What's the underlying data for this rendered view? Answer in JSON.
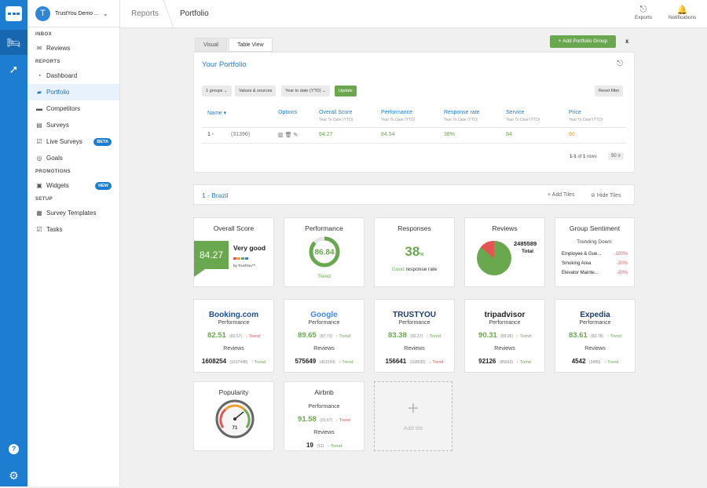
{
  "rail": {
    "icons": [
      "logo-icon",
      "hotel-icon",
      "rocket-icon",
      "help-icon",
      "gear-icon"
    ]
  },
  "account": {
    "initial": "T",
    "name": "TrustYou Demo ..."
  },
  "sidebar": {
    "inbox_label": "INBOX",
    "reports_label": "REPORTS",
    "promotions_label": "PROMOTIONS",
    "setup_label": "SETUP",
    "items": [
      {
        "label": "Reviews",
        "icon": "✉"
      },
      {
        "label": "Dashboard",
        "icon": "◔"
      },
      {
        "label": "Portfolio",
        "icon": "▰"
      },
      {
        "label": "Competitors",
        "icon": "▬"
      },
      {
        "label": "Surveys",
        "icon": "▤"
      },
      {
        "label": "Live Surveys",
        "icon": "☑",
        "badge": "BETA"
      },
      {
        "label": "Goals",
        "icon": "◎"
      },
      {
        "label": "Widgets",
        "icon": "▣",
        "badge": "NEW"
      },
      {
        "label": "Survey Templates",
        "icon": "▦"
      },
      {
        "label": "Tasks",
        "icon": "☑"
      }
    ]
  },
  "header": {
    "crumb1": "Reports",
    "crumb2": "Portfolio",
    "exports": "Exports",
    "notifications": "Notifications"
  },
  "tabs": {
    "visual": "Visual",
    "table": "Table View"
  },
  "add_group": "+ Add Portfolio Group",
  "close": "x",
  "portfolio": {
    "title": "Your Portfolio",
    "filters": {
      "groups": "1 groups ⌄",
      "values": "Values & sources",
      "period": "Year to date (YTD) ⌄",
      "update": "Update",
      "reset": "Reset filter"
    },
    "columns": [
      {
        "label": "Name ▾",
        "sub": ""
      },
      {
        "label": "Options",
        "sub": ""
      },
      {
        "label": "Overall Score",
        "sub": "Year To Date (YTD)"
      },
      {
        "label": "Performance",
        "sub": "Year To Date (YTD)"
      },
      {
        "label": "Response rate",
        "sub": "Year To Date (YTD)"
      },
      {
        "label": "Service",
        "sub": "Year To Date (YTD)"
      },
      {
        "label": "Price",
        "sub": "Year To Date (YTD)"
      }
    ],
    "row": {
      "name": "1 -",
      "id": "(31396)",
      "overall": "84.27",
      "performance": "84.54",
      "response": "38%",
      "service": "84",
      "price": "60"
    },
    "pagination": {
      "range": "1-1",
      "of": "of",
      "total": "1",
      "rows": "rows",
      "per_page": "50"
    }
  },
  "group": {
    "title": "1 - Brazil",
    "add_tiles": "Add Tiles",
    "hide_tiles": "Hide Tiles"
  },
  "tiles": {
    "overall": {
      "title": "Overall Score",
      "score": "84.27",
      "label": "Very good",
      "by": "by TrustYou™"
    },
    "performance": {
      "title": "Performance",
      "value": "86.84",
      "trend": "Trend",
      "fraction": 0.87
    },
    "responses": {
      "title": "Responses",
      "value": "38",
      "unit": "%",
      "label_good": "Good",
      "label_rest": "response rate"
    },
    "reviews": {
      "title": "Reviews",
      "count": "2485589",
      "total": "Total"
    },
    "sentiment": {
      "title": "Group Sentiment",
      "subtitle": "Trending Down:",
      "items": [
        {
          "label": "Employee & Gue...",
          "value": "-100%"
        },
        {
          "label": "Smoking Area",
          "value": "-30%"
        },
        {
          "label": "Elevator Mainte...",
          "value": "-20%"
        }
      ]
    },
    "sources": [
      {
        "brand": "Booking.com",
        "perf": "82.51",
        "prev": "(82.67)",
        "ptrend": "Trend",
        "pdir": "down",
        "reviews": "1608254",
        "rprev": "(1537448)",
        "rtrend": "Trend",
        "rdir": "up"
      },
      {
        "brand": "Google",
        "perf": "89.65",
        "prev": "(87.73)",
        "ptrend": "Trend",
        "pdir": "up",
        "reviews": "575649",
        "rprev": "(463104)",
        "rtrend": "Trend",
        "rdir": "up"
      },
      {
        "brand": "TRUSTYOU",
        "perf": "83.38",
        "prev": "(83.37)",
        "ptrend": "Trend",
        "pdir": "up",
        "reviews": "156641",
        "rprev": "(168030)",
        "rtrend": "Trend",
        "rdir": "down"
      },
      {
        "brand": "tripadvisor",
        "perf": "90.31",
        "prev": "(89.26)",
        "ptrend": "Trend",
        "pdir": "up",
        "reviews": "92126",
        "rprev": "(85810)",
        "rtrend": "Trend",
        "rdir": "up"
      },
      {
        "brand": "Expedia",
        "perf": "83.61",
        "prev": "(83.78)",
        "ptrend": "Trend",
        "pdir": "up",
        "reviews": "4542",
        "rprev": "(3489)",
        "rtrend": "Trend",
        "rdir": "up"
      }
    ],
    "perf_label": "Performance",
    "reviews_label": "Reviews",
    "popularity": {
      "title": "Popularity",
      "value": "71"
    },
    "airbnb": {
      "title": "Airbnb",
      "perf": "91.58",
      "prev": "(91.67)",
      "ptrend": "Trend",
      "reviews": "19",
      "rprev": "(12)",
      "rtrend": "Trend"
    },
    "add_tile": {
      "label": "Add tile"
    }
  },
  "colors": {
    "primary": "#1d7dd0",
    "green": "#6aa84f",
    "red": "#e55353",
    "orange": "#f0a030"
  }
}
